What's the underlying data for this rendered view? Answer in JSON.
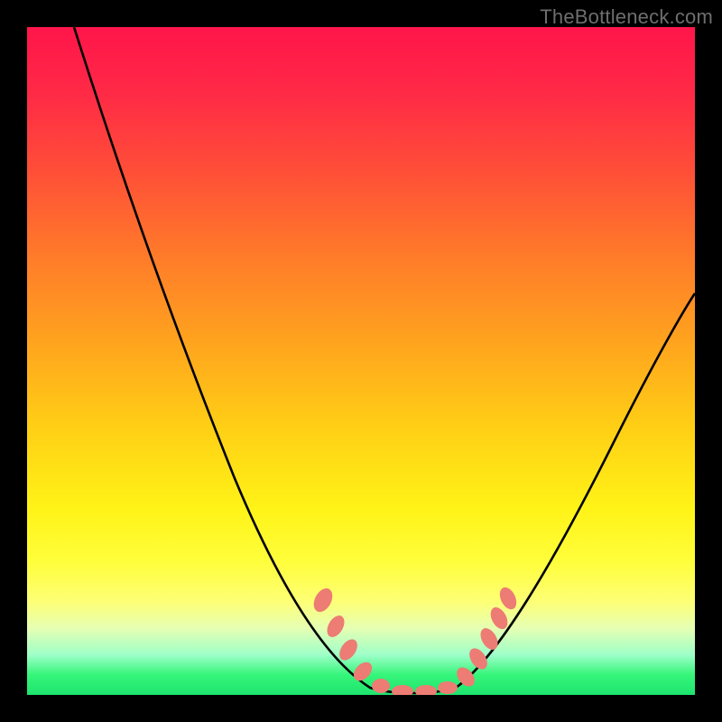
{
  "watermark": "TheBottleneck.com",
  "chart_data": {
    "type": "line",
    "title": "",
    "xlabel": "",
    "ylabel": "",
    "xlim": [
      0,
      100
    ],
    "ylim": [
      0,
      100
    ],
    "gradient_colors": [
      "#ff154a",
      "#ff7a2a",
      "#fff317",
      "#1de46e"
    ],
    "series": [
      {
        "name": "bottleneck-curve",
        "color": "#000000",
        "x": [
          7,
          10,
          15,
          20,
          25,
          30,
          35,
          40,
          45,
          48,
          50,
          52,
          55,
          58,
          60,
          63,
          65,
          70,
          75,
          80,
          85,
          90,
          95,
          100
        ],
        "y": [
          100,
          92,
          80,
          68,
          57,
          46,
          36,
          27,
          18,
          12,
          8,
          4,
          1,
          0,
          0,
          1,
          3,
          8,
          14,
          21,
          28,
          36,
          44,
          52
        ]
      },
      {
        "name": "notch-markers",
        "color": "#ec7c74",
        "type": "scatter",
        "x": [
          44,
          46,
          48,
          50,
          52,
          54,
          56,
          58,
          60,
          62,
          64,
          66,
          67,
          69
        ],
        "y": [
          14,
          11,
          8,
          5,
          3,
          1,
          0,
          0,
          0,
          1,
          3,
          6,
          9,
          13
        ]
      }
    ],
    "background_encoding": "vertical gradient from red (high bottleneck) through yellow to green (no bottleneck)"
  }
}
